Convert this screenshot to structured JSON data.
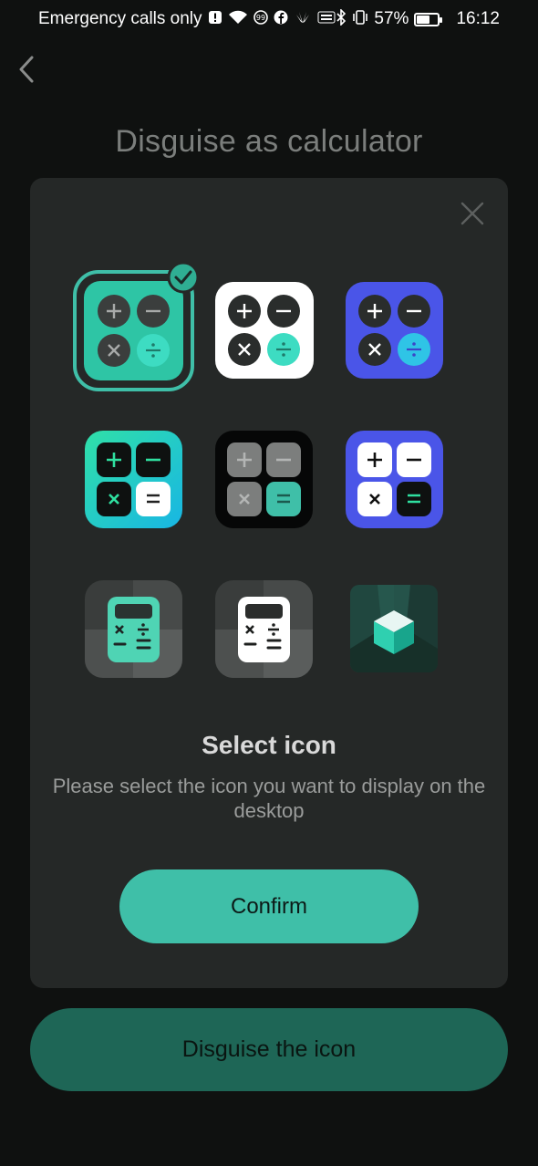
{
  "status_bar": {
    "carrier": "Emergency calls only",
    "battery": "57%",
    "time": "16:12"
  },
  "header": {
    "title": "Disguise as calculator"
  },
  "dialog": {
    "title": "Select icon",
    "description": "Please select the icon you want to display on the desktop",
    "confirm_label": "Confirm",
    "selected_index": 0,
    "icons": [
      {
        "name": "teal-calculator-icon",
        "selected": true
      },
      {
        "name": "white-calculator-icon",
        "selected": false
      },
      {
        "name": "blue-calculator-icon",
        "selected": false
      },
      {
        "name": "gradient-calculator-icon",
        "selected": false
      },
      {
        "name": "dark-calculator-icon",
        "selected": false
      },
      {
        "name": "blue-white-calculator-icon",
        "selected": false
      },
      {
        "name": "teal-handheld-calculator-icon",
        "selected": false
      },
      {
        "name": "white-handheld-calculator-icon",
        "selected": false
      },
      {
        "name": "cube-app-icon",
        "selected": false
      }
    ]
  },
  "footer": {
    "disguise_label": "Disguise the icon"
  },
  "colors": {
    "accent": "#3fbfa8",
    "accent_dark": "#1e6656",
    "dialog_bg": "#252827",
    "page_bg": "#0f1110"
  }
}
